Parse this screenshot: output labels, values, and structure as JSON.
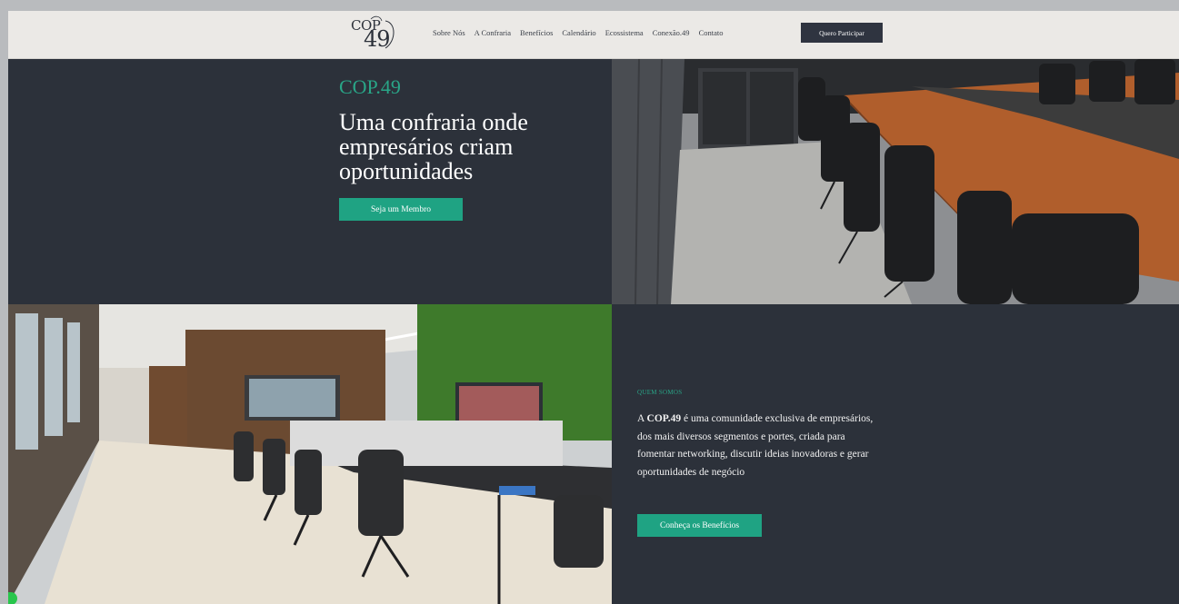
{
  "brand": {
    "logo_text_top": "COP",
    "logo_text_num": "49"
  },
  "nav": {
    "items": [
      {
        "label": "Sobre Nós"
      },
      {
        "label": "A Confraria"
      },
      {
        "label": "Benefícios"
      },
      {
        "label": "Calendário"
      },
      {
        "label": "Ecossistema"
      },
      {
        "label": "Conexão.49"
      },
      {
        "label": "Contato"
      }
    ],
    "cta_label": "Quero Participar"
  },
  "hero": {
    "brand": "COP.49",
    "title": "Uma confraria onde empresários criam oportunidades",
    "button_label": "Seja um Membro",
    "image_icon": "boardroom-photo"
  },
  "office": {
    "image_icon": "office-photo"
  },
  "about": {
    "kicker": "QUEM SOMOS",
    "text_prefix": "A ",
    "text_brand": "COP.49",
    "text_rest": " é uma comunidade exclusiva de empresários, dos mais diversos segmentos e portes, criada para fomentar networking, discutir ideias inovadoras e gerar oportunidades de negócio",
    "button_label": "Conheça os Benefícios"
  },
  "colors": {
    "accent": "#1fa383",
    "dark": "#2c313a",
    "nav_bg": "#ebe9e6"
  }
}
